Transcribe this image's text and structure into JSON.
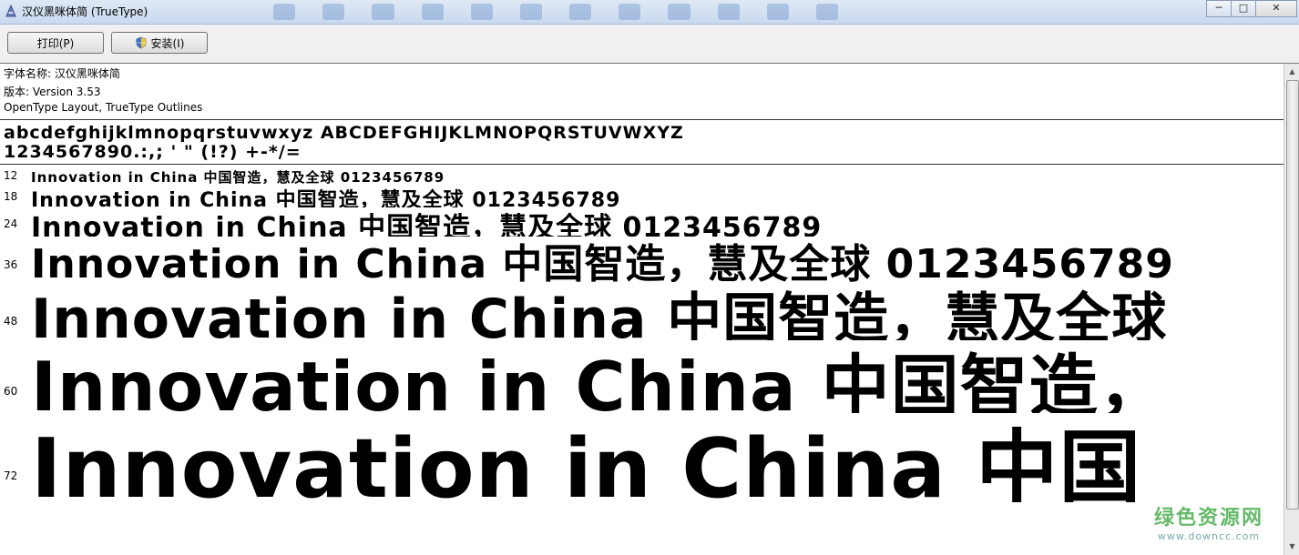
{
  "window": {
    "title": "汉仪黑咪体简 (TrueType)",
    "min_glyph": "─",
    "max_glyph": "□",
    "close_glyph": "✕"
  },
  "toolbar": {
    "print_label": "打印(P)",
    "install_label": "安装(I)"
  },
  "info": {
    "font_name_line": "字体名称: 汉仪黑咪体简",
    "version_line": "版本: Version 3.53",
    "type_line": "OpenType Layout, TrueType Outlines"
  },
  "charset": {
    "line1": "abcdefghijklmnopqrstuvwxyz ABCDEFGHIJKLMNOPQRSTUVWXYZ",
    "line2": "1234567890.:,; ' \" (!?) +-*/="
  },
  "samples": [
    {
      "size": "12",
      "text": "Innovation in China 中国智造，慧及全球 0123456789"
    },
    {
      "size": "18",
      "text": "Innovation in China 中国智造，慧及全球 0123456789"
    },
    {
      "size": "24",
      "text": "Innovation in China 中国智造，慧及全球 0123456789"
    },
    {
      "size": "36",
      "text": "Innovation in China 中国智造，慧及全球 0123456789"
    },
    {
      "size": "48",
      "text": "Innovation in China 中国智造，慧及全球"
    },
    {
      "size": "60",
      "text": "Innovation in China 中国智造，"
    },
    {
      "size": "72",
      "text": "Innovation in China 中国"
    }
  ],
  "watermark": {
    "main": "绿色资源网",
    "sub": "www.downcc.com"
  },
  "scrollbar": {
    "up_glyph": "▲",
    "down_glyph": "▼"
  }
}
